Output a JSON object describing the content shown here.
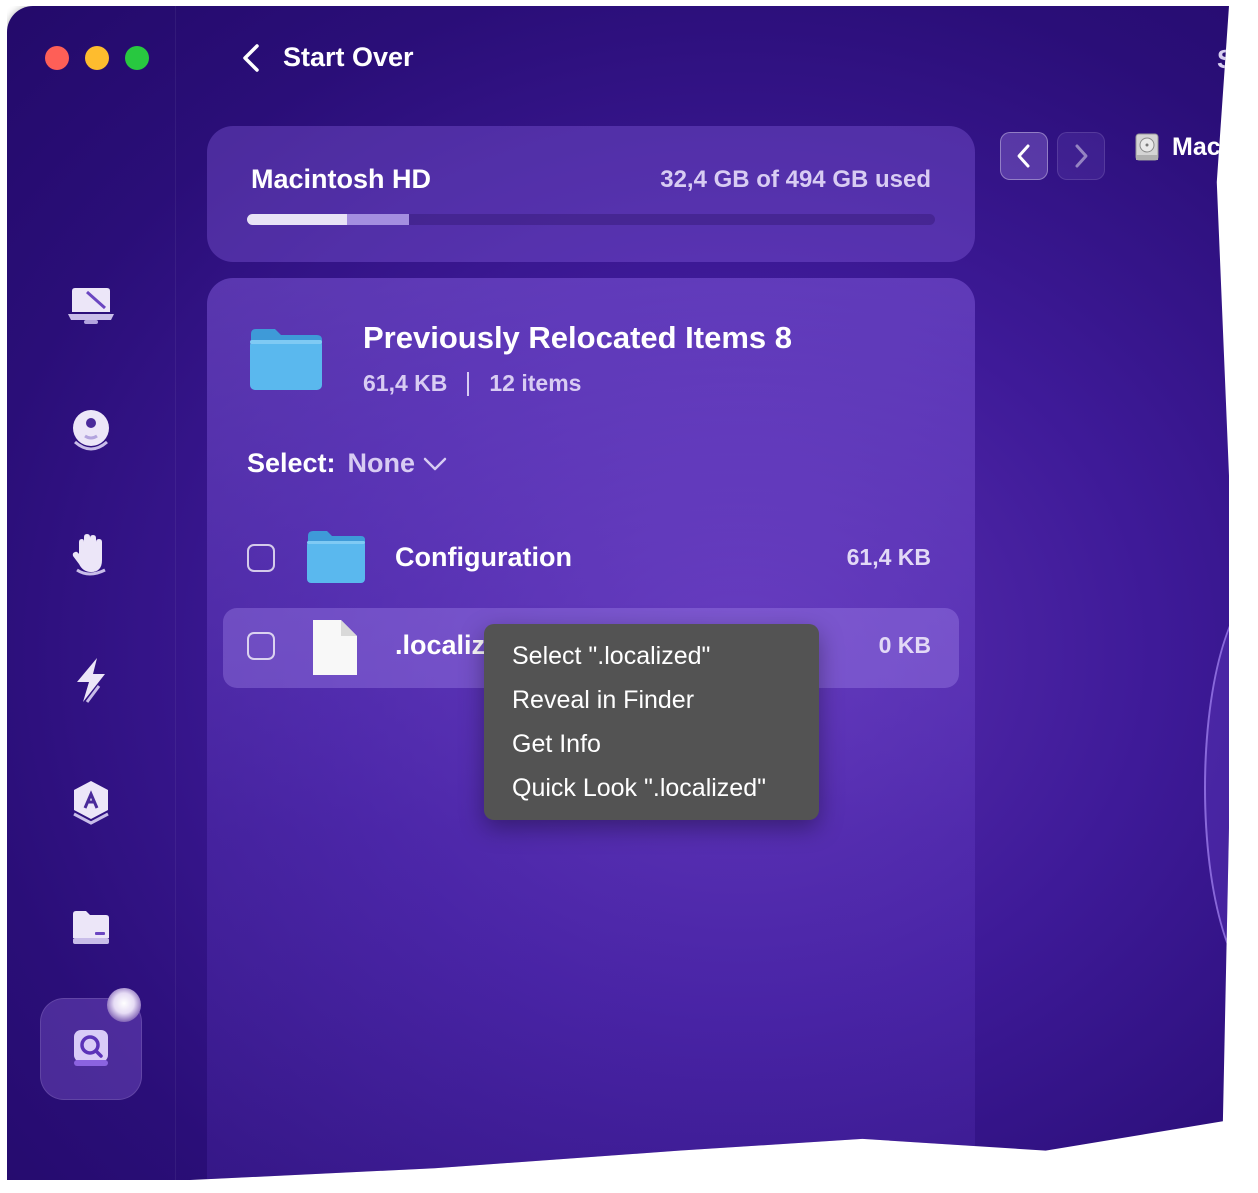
{
  "window": {
    "back_label": "Start Over",
    "right_partial_letter": "S"
  },
  "colors": {
    "background": "#3e1a98",
    "accent": "#a48ee0",
    "folder": "#4fb1ea",
    "menu": "#535353"
  },
  "sidebar": {
    "items": [
      {
        "icon": "laptop-icon"
      },
      {
        "icon": "privacy-icon"
      },
      {
        "icon": "hand-icon"
      },
      {
        "icon": "speed-icon"
      },
      {
        "icon": "apps-icon"
      },
      {
        "icon": "files-icon"
      },
      {
        "icon": "space-lens-icon",
        "active": true
      }
    ]
  },
  "disk": {
    "name": "Macintosh HD",
    "usage": "32,4 GB of 494 GB used",
    "used_fraction": 0.066,
    "other_fraction": 0.1
  },
  "folder": {
    "title": "Previously Relocated Items 8",
    "size": "61,4 KB",
    "count": "12 items"
  },
  "select": {
    "label": "Select:",
    "value": "None"
  },
  "items": [
    {
      "name": "Configuration",
      "size": "61,4 KB",
      "type": "folder",
      "checked": false
    },
    {
      "name": ".localiz",
      "size": "0 KB",
      "type": "file",
      "checked": false
    }
  ],
  "context_menu": {
    "items": [
      "Select \".localized\"",
      "Reveal in Finder",
      "Get Info",
      "Quick Look \".localized\""
    ]
  },
  "nav": {
    "crumb": "Mac"
  }
}
